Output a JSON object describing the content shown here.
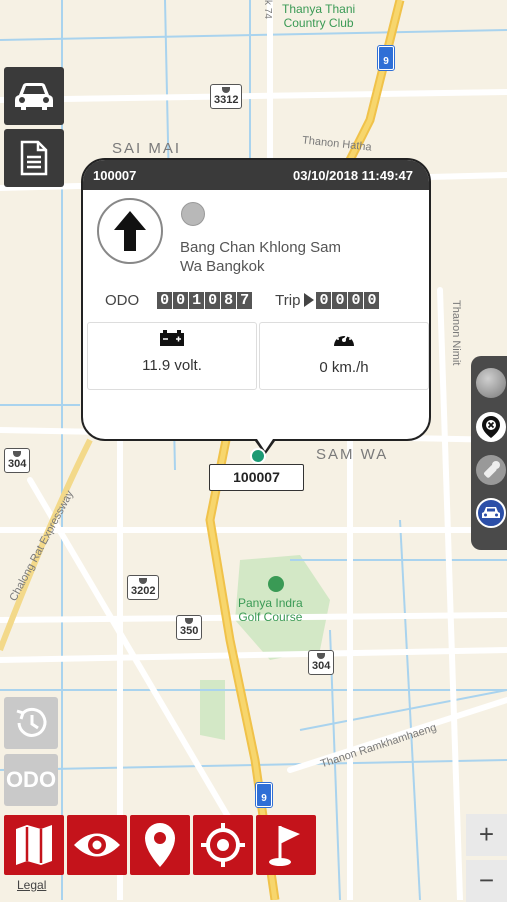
{
  "map": {
    "labels": {
      "club": "Thanya Thani\nCountry Club",
      "sai_mai": "SAI MAI",
      "thanon_hathai": "Thanon Hatha",
      "sam_wa": "SAM WA",
      "thanon_nimit": "Thanon Nimit",
      "chalong_rat": "Chalong Rat Expressway",
      "golf": "Panya Indra\nGolf Course",
      "ramkhamhaeng": "Thanon Ramkhamhaeng",
      "soi": "k 74"
    },
    "route_shields": [
      "3312",
      "304",
      "3202",
      "350",
      "304"
    ],
    "highway_shields": [
      "9",
      "9"
    ],
    "legal": "Legal",
    "colors": {
      "highway": "#f3c94e",
      "road": "#ffffff",
      "water": "#a9d3ee",
      "park": "#cfe6c4"
    }
  },
  "left_sidebar": {
    "car_icon": "car-icon",
    "report_icon": "document-icon"
  },
  "popup": {
    "device_id": "100007",
    "datetime": "03/10/2018 11:49:47",
    "location": "Bang Chan Khlong Sam\nWa Bangkok",
    "odo_label": "ODO",
    "odo_digits": [
      "0",
      "0",
      "1",
      "0",
      "8",
      "7"
    ],
    "trip_label": "Trip",
    "trip_digits": [
      "0",
      "0",
      "0",
      "0"
    ],
    "battery_value": "11.9 volt.",
    "speed_value": "0 km./h",
    "status_dot_color": "#b8b8b8"
  },
  "marker_label": "100007",
  "right_toolbar": {
    "items": [
      "status-dot-icon",
      "location-off-icon",
      "key-icon",
      "car-front-icon"
    ]
  },
  "left_lower": {
    "history_icon": "history-icon",
    "odo_button": "ODO"
  },
  "bottom_toolbar": {
    "buttons": [
      "map-icon",
      "eye-icon",
      "pin-icon",
      "target-icon",
      "flag-icon"
    ],
    "color": "#c4131b"
  },
  "zoom": {
    "plus": "+",
    "minus": "−"
  }
}
